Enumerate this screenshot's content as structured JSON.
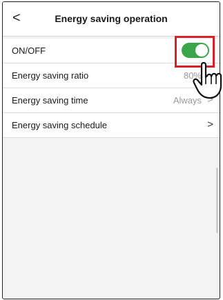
{
  "header": {
    "title": "Energy saving operation",
    "back_icon": "chevron-left-icon",
    "back_glyph": "<"
  },
  "rows": [
    {
      "label": "ON/OFF",
      "control": "toggle",
      "state": true
    },
    {
      "label": "Energy saving ratio",
      "value": "80%"
    },
    {
      "label": "Energy saving time",
      "value": "Always",
      "chevron": ">"
    },
    {
      "label": "Energy saving schedule",
      "value": "",
      "chevron": ">"
    }
  ],
  "colors": {
    "toggle_on": "#3aa54a",
    "highlight": "#d8202a"
  }
}
